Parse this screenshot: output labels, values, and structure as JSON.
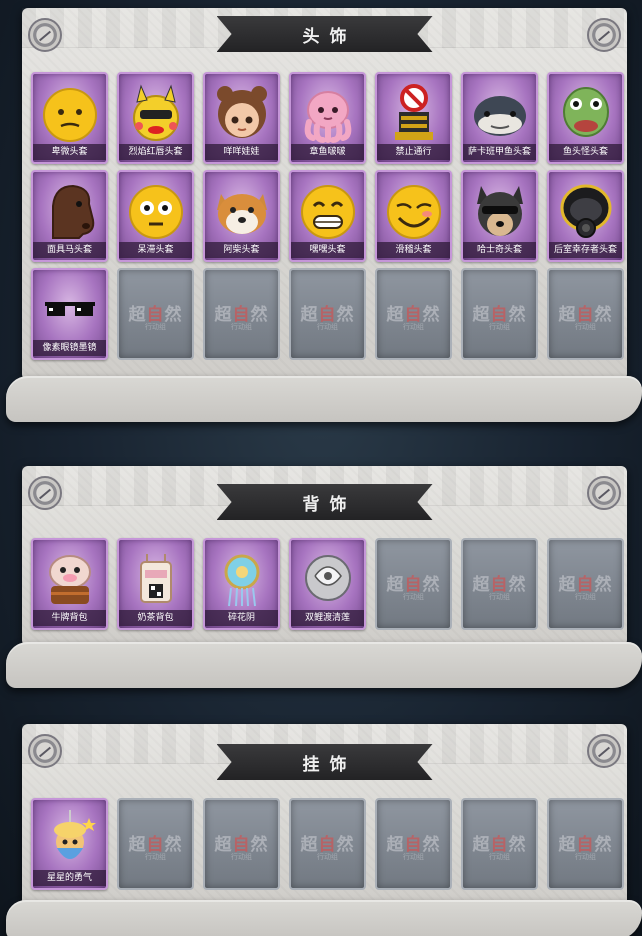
{
  "sections": [
    {
      "title": "头饰",
      "items": [
        {
          "name": "卑微头套",
          "icon": "sad-smiley-head-icon"
        },
        {
          "name": "烈焰红唇头套",
          "icon": "yellow-cartoon-head-icon"
        },
        {
          "name": "咩咩娃娃",
          "icon": "doll-head-icon"
        },
        {
          "name": "章鱼啵啵",
          "icon": "pink-octopus-icon"
        },
        {
          "name": "禁止通行",
          "icon": "no-entry-sign-icon"
        },
        {
          "name": "萨卡班甲鱼头套",
          "icon": "fish-head-icon"
        },
        {
          "name": "鱼头怪头套",
          "icon": "green-fish-head-icon"
        },
        {
          "name": "面具马头套",
          "icon": "horse-head-icon"
        },
        {
          "name": "呆滞头套",
          "icon": "staring-emoji-head-icon"
        },
        {
          "name": "阿柴头套",
          "icon": "shiba-dog-head-icon"
        },
        {
          "name": "嘿嘿头套",
          "icon": "grinning-emoji-head-icon"
        },
        {
          "name": "滑稽头套",
          "icon": "smirk-emoji-head-icon"
        },
        {
          "name": "哈士奇头套",
          "icon": "husky-sunglasses-head-icon"
        },
        {
          "name": "后室幸存者头套",
          "icon": "gas-mask-helmet-icon"
        },
        {
          "name": "像素眼镜墨镜",
          "icon": "pixel-sunglasses-icon"
        }
      ],
      "empty_count": 6
    },
    {
      "title": "背饰",
      "items": [
        {
          "name": "牛牌背包",
          "icon": "cow-backpack-icon"
        },
        {
          "name": "奶茶背包",
          "icon": "milk-tea-backpack-icon"
        },
        {
          "name": "碎花阴",
          "icon": "floral-ornament-icon"
        },
        {
          "name": "双鲤渡清莲",
          "icon": "twin-koi-lotus-icon"
        }
      ],
      "empty_count": 3
    },
    {
      "title": "挂饰",
      "items": [
        {
          "name": "星星的勇气",
          "icon": "star-charm-pendant-icon"
        }
      ],
      "empty_count": 6
    }
  ],
  "watermark": {
    "text_left": "超",
    "text_mid": "自",
    "text_right": "然",
    "sub": "行动组"
  }
}
